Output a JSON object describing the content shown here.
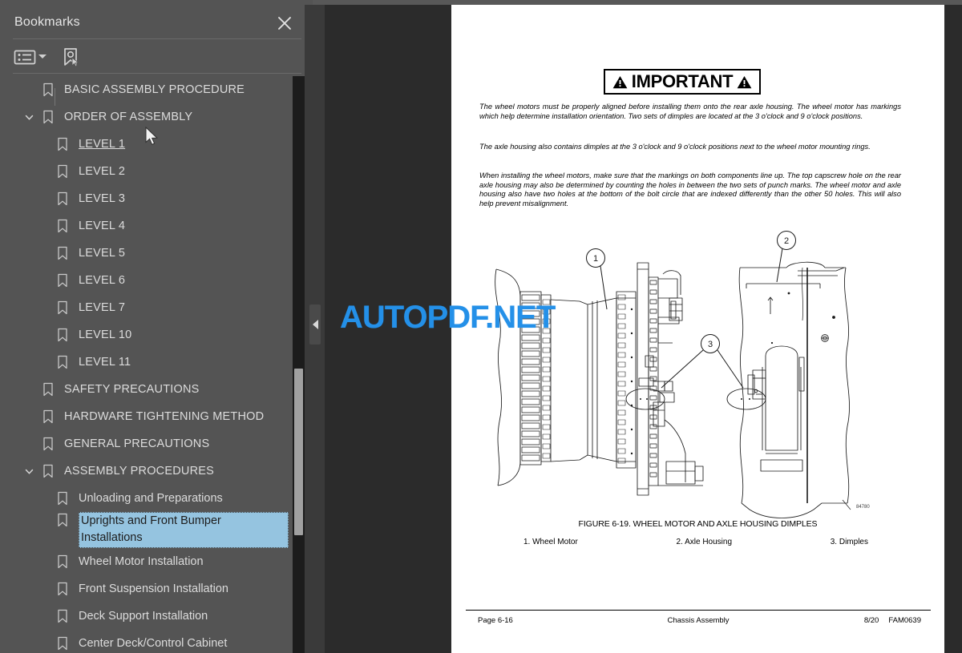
{
  "panel": {
    "title": "Bookmarks",
    "close_icon": "close-icon",
    "toolbar": {
      "options_icon": "list-options-icon",
      "options_caret": "chevron-down-icon",
      "new_bookmark_icon": "new-bookmark-icon"
    }
  },
  "bookmarks": [
    {
      "label": "BASIC ASSEMBLY PROCEDURE",
      "level": 0,
      "expandable": false,
      "state": "normal"
    },
    {
      "label": "ORDER OF ASSEMBLY",
      "level": 0,
      "expandable": true,
      "expanded": true,
      "state": "normal"
    },
    {
      "label": "LEVEL 1",
      "level": 1,
      "expandable": false,
      "state": "hover"
    },
    {
      "label": "LEVEL 2",
      "level": 1,
      "expandable": false,
      "state": "normal"
    },
    {
      "label": "LEVEL 3",
      "level": 1,
      "expandable": false,
      "state": "normal"
    },
    {
      "label": "LEVEL 4",
      "level": 1,
      "expandable": false,
      "state": "normal"
    },
    {
      "label": "LEVEL 5",
      "level": 1,
      "expandable": false,
      "state": "normal"
    },
    {
      "label": "LEVEL 6",
      "level": 1,
      "expandable": false,
      "state": "normal"
    },
    {
      "label": "LEVEL 7",
      "level": 1,
      "expandable": false,
      "state": "normal"
    },
    {
      "label": "LEVEL 10",
      "level": 1,
      "expandable": false,
      "state": "normal"
    },
    {
      "label": "LEVEL 11",
      "level": 1,
      "expandable": false,
      "state": "normal"
    },
    {
      "label": "SAFETY PRECAUTIONS",
      "level": 0,
      "expandable": false,
      "state": "normal"
    },
    {
      "label": "HARDWARE TIGHTENING METHOD",
      "level": 0,
      "expandable": false,
      "state": "normal"
    },
    {
      "label": "GENERAL PRECAUTIONS",
      "level": 0,
      "expandable": false,
      "state": "normal"
    },
    {
      "label": "ASSEMBLY PROCEDURES",
      "level": 0,
      "expandable": true,
      "expanded": true,
      "state": "normal"
    },
    {
      "label": "Unloading and Preparations",
      "level": 1,
      "expandable": false,
      "state": "normal"
    },
    {
      "label": "Uprights and Front Bumper Installations",
      "level": 1,
      "expandable": false,
      "state": "selected"
    },
    {
      "label": "Wheel Motor Installation",
      "level": 1,
      "expandable": false,
      "state": "normal"
    },
    {
      "label": "Front Suspension Installation",
      "level": 1,
      "expandable": false,
      "state": "normal"
    },
    {
      "label": "Deck Support Installation",
      "level": 1,
      "expandable": false,
      "state": "normal"
    },
    {
      "label": "Center Deck/Control Cabinet",
      "level": 1,
      "expandable": false,
      "state": "normal"
    }
  ],
  "document": {
    "callout_box": {
      "text": "IMPORTANT",
      "left_icon": "warning-triangle-icon",
      "right_icon": "warning-triangle-icon"
    },
    "paragraphs": [
      "The wheel motors must be properly aligned before installing them onto the rear axle housing. The wheel motor has markings which help determine installation orientation. Two sets of dimples are located at the 3 o'clock and 9 o'clock positions.",
      "The axle housing also contains dimples at the 3 o'clock and 9 o'clock positions next to the wheel motor mounting rings.",
      "When installing the wheel motors, make sure that the markings on both components line up. The top capscrew hole on the rear axle housing may also be determined by counting the holes in between the two sets of punch marks. The wheel motor and axle housing also have two holes at the bottom of the bolt circle that are indexed differently than the other 50 holes. This will also help prevent misalignment."
    ],
    "figure": {
      "caption": "FIGURE 6-19. WHEEL MOTOR AND AXLE HOUSING DIMPLES",
      "drawing_id": "84780",
      "callouts": [
        "1",
        "2",
        "3"
      ],
      "legend": [
        "1. Wheel Motor",
        "2. Axle Housing",
        "3. Dimples"
      ]
    },
    "footer": {
      "page": "Page 6-16",
      "section": "Chassis Assembly",
      "count": "8/20",
      "doc_id": "FAM0639"
    }
  },
  "watermark": {
    "text": "AUTOPDF.NET",
    "color": "#2490e8"
  },
  "viewer": {
    "collapse_icon": "collapse-left-icon"
  },
  "colors": {
    "panel_bg": "#545454",
    "viewer_bg": "#2b2b2b",
    "selection": "#95c4e0",
    "text": "#dcdcdc"
  }
}
